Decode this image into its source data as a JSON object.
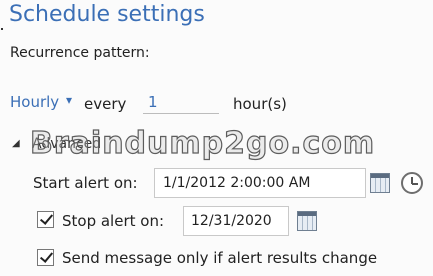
{
  "header": {
    "title": "Schedule settings"
  },
  "recurrence": {
    "label": "Recurrence pattern:",
    "frequency": "Hourly",
    "frequency_caret": "▾",
    "every_label": "every",
    "every_value": "1",
    "unit_label": "hour(s)"
  },
  "advanced": {
    "toggle": "◢",
    "label": "Advanced"
  },
  "watermark": {
    "text": "Braindump2go.com"
  },
  "start_alert": {
    "label": "Start alert on:",
    "value": "1/1/2012 2:00:00 AM"
  },
  "stop_alert": {
    "label": "Stop alert on:",
    "value": "12/31/2020",
    "checked": true
  },
  "send_message": {
    "label": "Send message only if alert results change",
    "checked": true
  }
}
